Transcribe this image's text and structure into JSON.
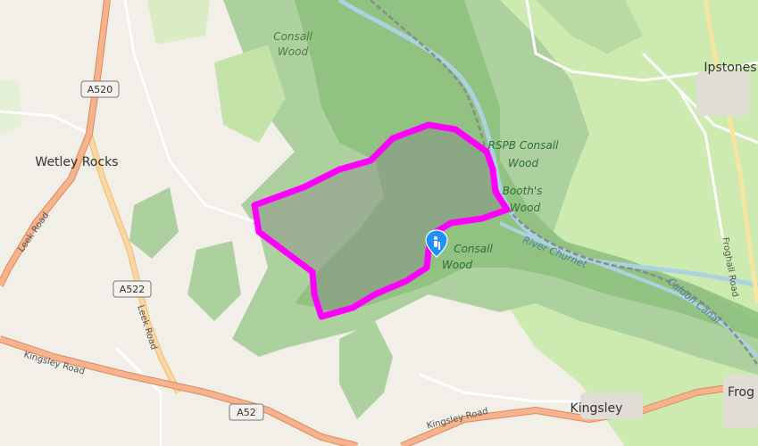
{
  "map": {
    "places": {
      "wetley_rocks": "Wetley Rocks",
      "ipstones": "Ipstones",
      "kingsley": "Kingsley",
      "froghall": "Frog"
    },
    "woods": {
      "consall_wood_top_1": "Consall",
      "consall_wood_top_2": "Wood",
      "rspb_1": "RSPB Consall",
      "rspb_2": "Wood",
      "booths_1": "Booth's",
      "booths_2": "Wood",
      "consall_wood_mid_1": "Consall",
      "consall_wood_mid_2": "Wood"
    },
    "roads": {
      "a520": "A520",
      "a522": "A522",
      "a52": "A52",
      "leek_road_left": "Leek Road",
      "leek_road_mid": "Leek Road",
      "kingsley_road_left": "Kingsley Road",
      "kingsley_road_right": "Kingsley Road",
      "froghall_road": "Froghall Road"
    },
    "water": {
      "river": "River Churnet",
      "canal": "Caldon Canal"
    },
    "colors": {
      "background": "#f2efe9",
      "woodland": "#add19e",
      "forest_dark": "#8cc07c",
      "route": "#ff00ff",
      "water": "#aad3df",
      "primary_road": "#fcd6a4",
      "trunk_road": "#f8b38c",
      "marker": "#1e90ff"
    },
    "marker_icon": "hiking-icon"
  }
}
